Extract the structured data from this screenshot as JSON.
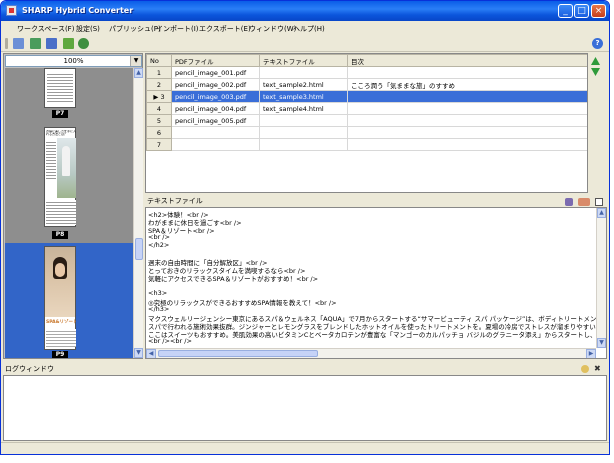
{
  "window": {
    "title": "SHARP Hybrid Converter"
  },
  "menu": [
    "ワークスペース(F)",
    "設定(S)",
    "パブリッシュ(P)",
    "インポート(I)",
    "エクスポート(E)",
    "ウィンドウ(W)",
    "ヘルプ(H)"
  ],
  "thumbs": {
    "zoom": "100%",
    "pages": [
      "P7",
      "P8",
      "P9"
    ],
    "p8_heading": "お得に美しさを手に入れる方法とは？",
    "p9_title": "SPA&リゾート"
  },
  "table": {
    "headers": [
      "No",
      "PDFファイル",
      "テキストファイル",
      "目次"
    ],
    "rows": [
      {
        "no": "1",
        "pdf": "pencil_image_001.pdf",
        "text": "",
        "toc": ""
      },
      {
        "no": "2",
        "pdf": "pencil_image_002.pdf",
        "text": "text_sample2.html",
        "toc": "こころ潤う「気ままな旅」のすすめ"
      },
      {
        "no": "3",
        "pdf": "pencil_image_003.pdf",
        "text": "text_sample3.html",
        "toc": ""
      },
      {
        "no": "4",
        "pdf": "pencil_image_004.pdf",
        "text": "text_sample4.html",
        "toc": ""
      },
      {
        "no": "5",
        "pdf": "pencil_image_005.pdf",
        "text": "",
        "toc": ""
      },
      {
        "no": "6",
        "pdf": "",
        "text": "",
        "toc": ""
      },
      {
        "no": "7",
        "pdf": "",
        "text": "",
        "toc": ""
      }
    ]
  },
  "textpane": {
    "title": "テキストファイル",
    "lines": [
      "<h2>体験！<br />",
      "わがままに休日を過ごす<br />",
      "SPA＆リゾート<br />",
      "<br />",
      "</h2>",
      "",
      "週末の自由時間に「自分解放区」<br />",
      "とっておきのリラックスタイムを満喫するなら<br />",
      "気軽にアクセスできるSPA＆リゾートがおすすめ！<br />",
      "",
      "<h3>",
      "◎究極のリラックスができるおすすめSPA情報を教えて！<br />",
      "</h3>",
      "マクスウェルリージェンシー東京にあるスパ＆ウェルネス「AQUA」で7月からスタートする“サマービューティ スパ パッケージ”は、ボディトリートメントとアクアマーンスイーツセット",
      "スパで行われる施術効果抜群。ジンジャーとレモングラスをブレンドしたホットオイルを使ったトリートメントを。夏場の冷房でストレスが溜まりやすい首、肩、腰をオールハンド",
      "ここはスイーツもおすすめ。美肌効果の高いビタミンCとベータカロテンが豊富な「マンゴーのカルパッチョ バジルのグラニータ添え」からスタートし、続くメインには「あなたがいつ",
      "<br /><br />"
    ]
  },
  "log": {
    "title": "ログウィンドウ"
  }
}
